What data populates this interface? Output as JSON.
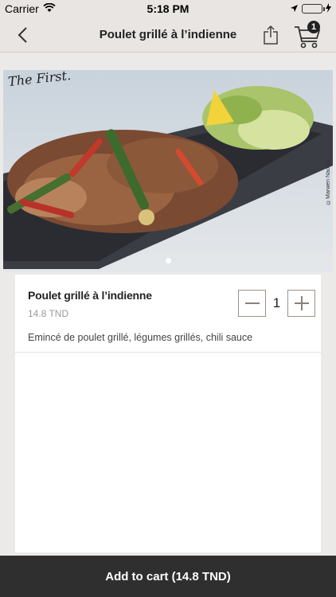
{
  "status_bar": {
    "carrier": "Carrier",
    "time": "5:18 PM"
  },
  "nav": {
    "title": "Poulet grillé à l’indienne",
    "cart_count": "1"
  },
  "hero": {
    "logo": "The First.",
    "watermark": "©Marwen Naouar",
    "dots": 1,
    "active_dot": 0
  },
  "item": {
    "name": "Poulet grillé à l’indienne",
    "price": "14.8 TND",
    "description": "Emincé de poulet grillé, légumes grillés, chili sauce",
    "quantity": "1"
  },
  "cart_button": {
    "label": "Add to cart (14.8 TND)"
  },
  "colors": {
    "nav_bg": "#e8e5e2",
    "page_bg": "#eceae8",
    "button_bg": "#2f2f2f",
    "stepper_border": "#9b928b"
  }
}
